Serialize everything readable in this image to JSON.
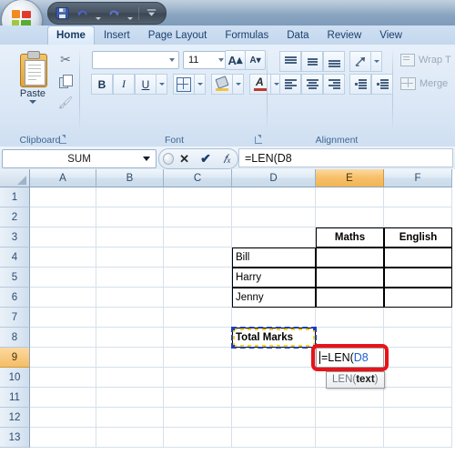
{
  "window": {
    "office_button": "office-orb",
    "quick_access": [
      {
        "name": "save",
        "icon": "floppy-disk-icon"
      },
      {
        "name": "undo",
        "icon": "undo-arrow-icon"
      },
      {
        "name": "redo",
        "icon": "redo-arrow-icon"
      },
      {
        "name": "customize",
        "icon": "customize-qat-icon"
      }
    ]
  },
  "ribbon": {
    "tabs": [
      {
        "label": "Home",
        "active": true
      },
      {
        "label": "Insert",
        "active": false
      },
      {
        "label": "Page Layout",
        "active": false
      },
      {
        "label": "Formulas",
        "active": false
      },
      {
        "label": "Data",
        "active": false
      },
      {
        "label": "Review",
        "active": false
      },
      {
        "label": "View",
        "active": false
      }
    ],
    "groups": {
      "clipboard": {
        "label": "Clipboard",
        "paste_label": "Paste",
        "buttons": [
          "Cut",
          "Copy",
          "Format Painter"
        ]
      },
      "font": {
        "label": "Font",
        "font_name": "",
        "font_name_placeholder": "",
        "font_size": "11",
        "grow_label": "A",
        "shrink_label": "A",
        "bold_label": "B",
        "italic_label": "I",
        "underline_label": "U"
      },
      "alignment": {
        "label": "Alignment",
        "wrap_text_label": "Wrap T",
        "merge_label": "Merge",
        "disabled": true
      }
    }
  },
  "formula_bar": {
    "name_box_value": "SUM",
    "cancel_label": "✕",
    "enter_label": "✔",
    "insert_function_label": "fx",
    "formula_value": "=LEN(D8"
  },
  "grid": {
    "columns": [
      {
        "label": "A",
        "selected": false
      },
      {
        "label": "B",
        "selected": false
      },
      {
        "label": "C",
        "selected": false
      },
      {
        "label": "D",
        "selected": false
      },
      {
        "label": "E",
        "selected": true
      },
      {
        "label": "F",
        "selected": false
      }
    ],
    "rows": [
      {
        "label": "1",
        "selected": false
      },
      {
        "label": "2",
        "selected": false
      },
      {
        "label": "3",
        "selected": false
      },
      {
        "label": "4",
        "selected": false
      },
      {
        "label": "5",
        "selected": false
      },
      {
        "label": "6",
        "selected": false
      },
      {
        "label": "7",
        "selected": false
      },
      {
        "label": "8",
        "selected": false
      },
      {
        "label": "9",
        "selected": true
      },
      {
        "label": "10",
        "selected": false
      },
      {
        "label": "11",
        "selected": false
      },
      {
        "label": "12",
        "selected": false
      },
      {
        "label": "13",
        "selected": false
      }
    ],
    "cells": [
      {
        "ref": "E3",
        "col": 4,
        "row": 3,
        "value": "Maths",
        "bold": true,
        "align": "center",
        "boxed": true
      },
      {
        "ref": "F3",
        "col": 5,
        "row": 3,
        "value": "English",
        "bold": true,
        "align": "center",
        "boxed": true
      },
      {
        "ref": "D4",
        "col": 3,
        "row": 4,
        "value": "Bill",
        "bold": false,
        "align": "left",
        "boxed": true
      },
      {
        "ref": "E4",
        "col": 4,
        "row": 4,
        "value": "",
        "bold": false,
        "align": "left",
        "boxed": true
      },
      {
        "ref": "F4",
        "col": 5,
        "row": 4,
        "value": "",
        "bold": false,
        "align": "left",
        "boxed": true
      },
      {
        "ref": "D5",
        "col": 3,
        "row": 5,
        "value": "Harry",
        "bold": false,
        "align": "left",
        "boxed": true
      },
      {
        "ref": "E5",
        "col": 4,
        "row": 5,
        "value": "",
        "bold": false,
        "align": "left",
        "boxed": true
      },
      {
        "ref": "F5",
        "col": 5,
        "row": 5,
        "value": "",
        "bold": false,
        "align": "left",
        "boxed": true
      },
      {
        "ref": "D6",
        "col": 3,
        "row": 6,
        "value": "Jenny",
        "bold": false,
        "align": "left",
        "boxed": true
      },
      {
        "ref": "E6",
        "col": 4,
        "row": 6,
        "value": "",
        "bold": false,
        "align": "left",
        "boxed": true
      },
      {
        "ref": "F6",
        "col": 5,
        "row": 6,
        "value": "",
        "bold": false,
        "align": "left",
        "boxed": true
      },
      {
        "ref": "D8",
        "col": 3,
        "row": 8,
        "value": "Total Marks",
        "bold": true,
        "align": "left",
        "boxed": true
      }
    ],
    "copy_marquee_cell": "D8",
    "editing_cell": "E9",
    "editing_text_prefix": "=LEN(",
    "editing_text_ref": "D8",
    "editing_ref_color": "#1f5fd0"
  },
  "annotation": {
    "highlight_color": "#e8131a",
    "highlight_target": "E9"
  },
  "tooltip": {
    "prefix": "LEN(",
    "argument": "text",
    "suffix": ")"
  }
}
